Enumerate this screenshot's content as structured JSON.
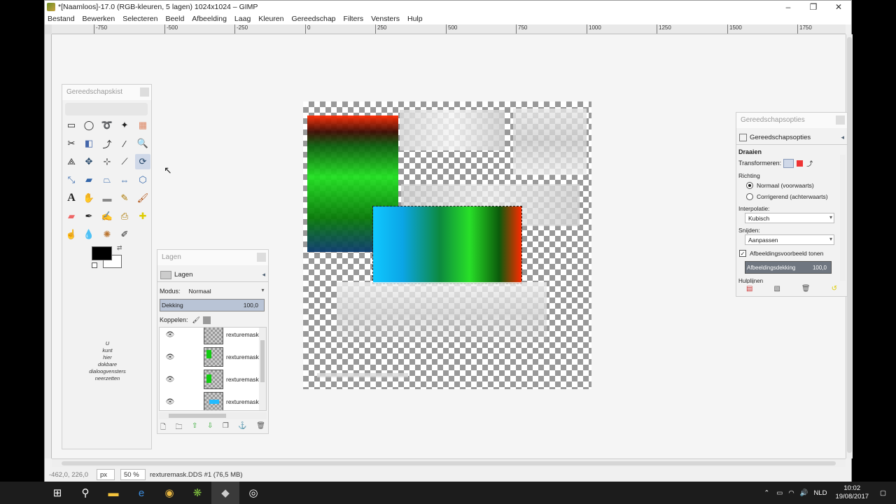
{
  "window": {
    "title": "*[Naamloos]-17.0 (RGB-kleuren, 5 lagen) 1024x1024 – GIMP",
    "minimize": "–",
    "restore": "❐",
    "close": "✕"
  },
  "menu": [
    "Bestand",
    "Bewerken",
    "Selecteren",
    "Beeld",
    "Afbeelding",
    "Laag",
    "Kleuren",
    "Gereedschap",
    "Filters",
    "Vensters",
    "Hulp"
  ],
  "ruler_labels": [
    "-750",
    "-500",
    "-250",
    "0",
    "250",
    "500",
    "750",
    "1000",
    "1250",
    "1500",
    "1750"
  ],
  "toolbox": {
    "title": "Gereedschapskist",
    "dock_hint": [
      "U",
      "kunt",
      "hier",
      "dokbare",
      "dialoogvensters",
      "neerzetten"
    ],
    "tools": [
      "rect-select",
      "ellipse-select",
      "free-select",
      "fuzzy-select",
      "color-select",
      "scissors",
      "foreground-select",
      "paths",
      "color-picker",
      "zoom",
      "measure",
      "move",
      "align",
      "crop",
      "rotate",
      "scale",
      "shear",
      "perspective",
      "flip",
      "cage",
      "text",
      "heal",
      "bucket-fill",
      "pencil",
      "paintbrush",
      "eraser",
      "airbrush",
      "ink",
      "clone",
      "smudge",
      "dodge",
      "blur",
      "dodge-burn",
      "smudge2"
    ]
  },
  "colors": {
    "fg": "#000000",
    "bg": "#ffffff"
  },
  "layers_panel": {
    "title": "Lagen",
    "tab": "Lagen",
    "mode_label": "Modus:",
    "mode_value": "Normaal",
    "opacity_label": "Dekking",
    "opacity_value": "100,0",
    "lock_label": "Koppelen:",
    "layers": [
      {
        "name": "rexturemask."
      },
      {
        "name": "rexturemask."
      },
      {
        "name": "rexturemask."
      },
      {
        "name": "rexturemask."
      }
    ]
  },
  "tool_options": {
    "title": "Gereedschapsopties",
    "tab": "Gereedschapsopties",
    "tool_name": "Draaien",
    "transform_label": "Transformeren:",
    "direction_label": "Richting",
    "direction_normal": "Normaal (voorwaarts)",
    "direction_corrective": "Corrigerend (achterwaarts)",
    "interpolation_label": "Interpolatie:",
    "interpolation_value": "Kubisch",
    "clipping_label": "Snijden:",
    "clipping_value": "Aanpassen",
    "preview_label": "Afbeeldingsvoorbeeld tonen",
    "image_opacity_label": "Afbeeldingsdekking",
    "image_opacity_value": "100,0",
    "guides_label": "Hulplijnen"
  },
  "status": {
    "coords": "-462,0, 226,0",
    "unit": "px",
    "zoom": "50 %",
    "message": "rexturemask.DDS #1 (76,5 MB)"
  },
  "taskbar": {
    "lang": "NLD",
    "time": "10:02",
    "date": "19/08/2017"
  }
}
